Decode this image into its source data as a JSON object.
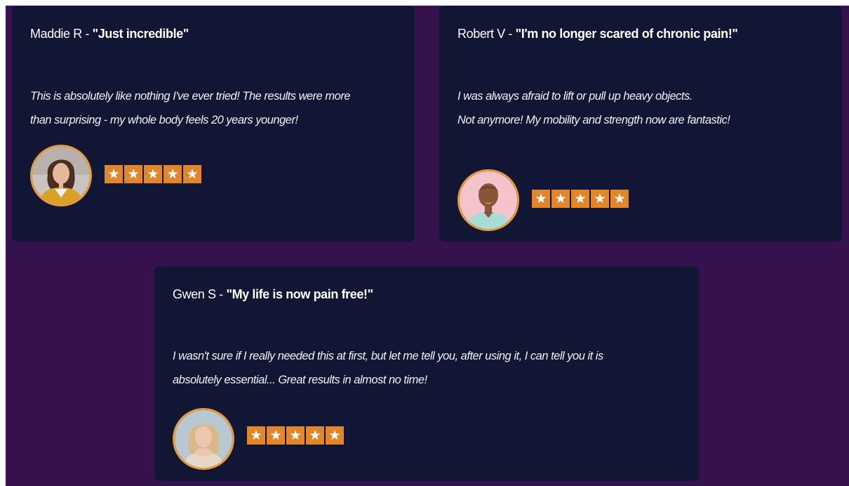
{
  "palette": {
    "background": "#35124e",
    "card": "#101633",
    "star_accent": "#e2862b",
    "avatar_ring": "#e89a3c"
  },
  "testimonials": [
    {
      "name": "Maddie R - ",
      "title": "\"Just incredible\"",
      "lines": [
        "This is absolutely like nothing I've ever tried! The results were more",
        "than surprising - my whole body feels 20 years younger!"
      ],
      "rating": 5,
      "avatar_icon": "woman-portrait-icon"
    },
    {
      "name": "Robert V - ",
      "title": "\"I'm no longer scared of chronic pain!\"",
      "lines": [
        "I was always afraid to lift or pull up heavy objects.",
        "Not anymore! My mobility and strength now are fantastic!"
      ],
      "rating": 5,
      "avatar_icon": "man-portrait-icon"
    },
    {
      "name": "Gwen S - ",
      "title": "\"My life is now pain free!\"",
      "lines": [
        "I wasn't sure if I really needed this at first, but let me tell you, after using it, I can tell you it is",
        "absolutely essential... Great results in almost no time!"
      ],
      "rating": 5,
      "avatar_icon": "woman-portrait-icon"
    }
  ]
}
